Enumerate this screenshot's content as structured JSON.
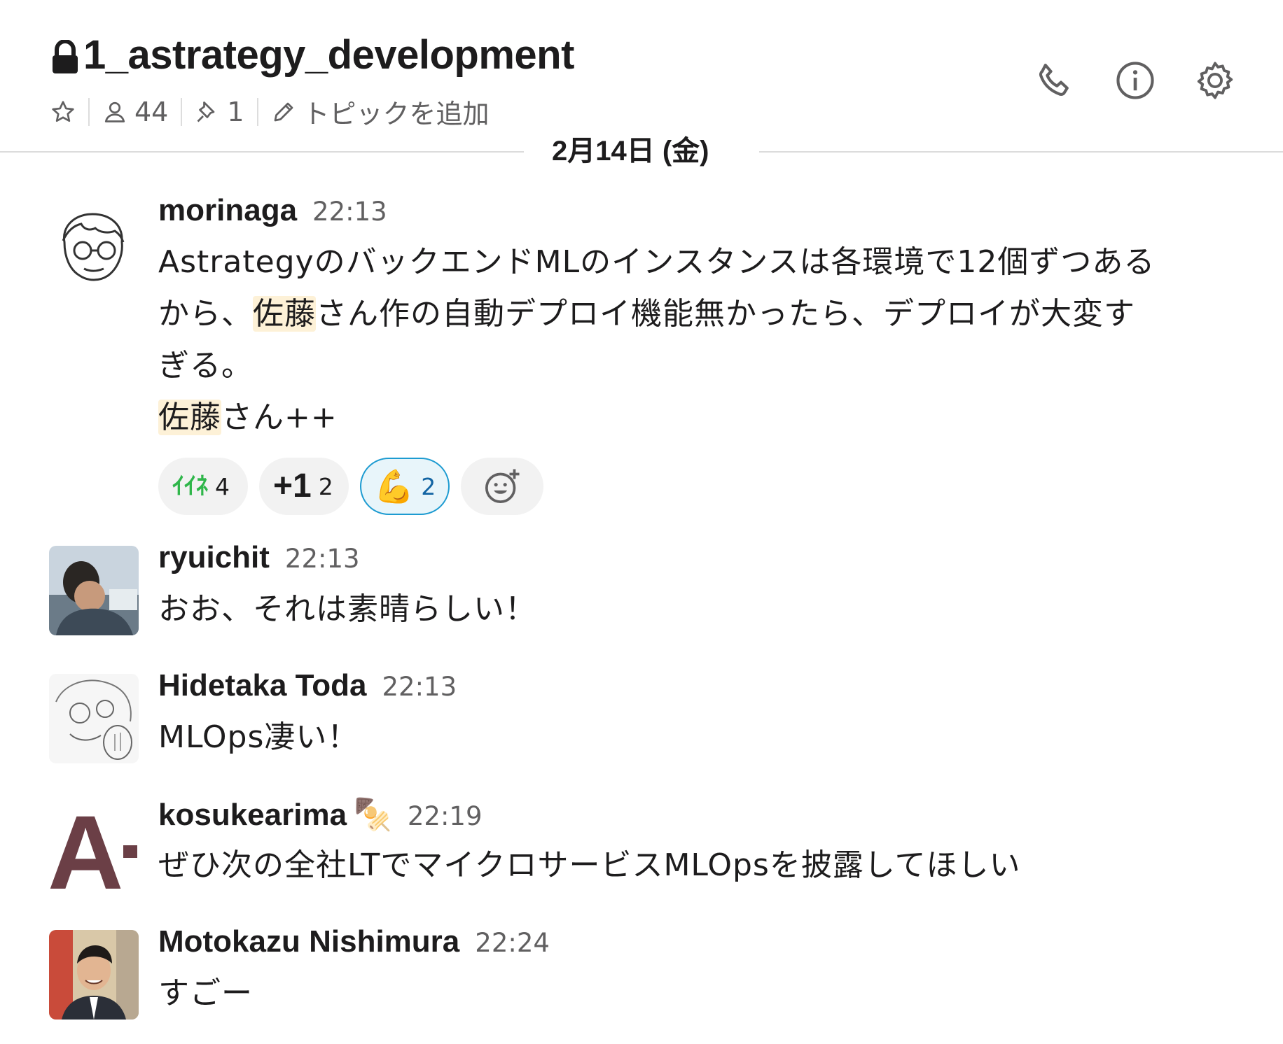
{
  "channel": {
    "name": "1_astrategy_development",
    "member_count": "44",
    "pinned_count": "1",
    "topic_placeholder": "トピックを追加"
  },
  "date_divider": "2月14日 (金)",
  "messages": [
    {
      "author": "morinaga",
      "time": "22:13",
      "text_parts": {
        "line1": "AstrategyのバックエンドMLのインスタンスは各環境で12個ずつある",
        "line2_prefix": "から、",
        "mention": "佐藤",
        "line2_suffix": "さん作の自動デプロイ機能無かったら、デプロイが大変す",
        "line3": "ぎる。",
        "line4_mention": "佐藤",
        "line4_suffix": "さん++"
      },
      "reactions": [
        {
          "emoji": "ｲｲﾈ",
          "count": "4"
        },
        {
          "emoji": "+1",
          "count": "2"
        },
        {
          "emoji": "💪",
          "count": "2"
        }
      ]
    },
    {
      "author": "ryuichit",
      "time": "22:13",
      "text": "おお、それは素晴らしい！"
    },
    {
      "author": "Hidetaka Toda",
      "time": "22:13",
      "text": "MLOps凄い！"
    },
    {
      "author": "kosukearima",
      "status_emoji": "🍢",
      "time": "22:19",
      "text": "ぜひ次の全社LTでマイクロサービスMLOpsを披露してほしい",
      "avatar_letter": "A"
    },
    {
      "author": "Motokazu Nishimura",
      "time": "22:24",
      "text": "すごー"
    }
  ],
  "icons": {
    "lock": "lock-icon",
    "star": "star-icon",
    "members": "person-icon",
    "pin": "pin-icon",
    "pencil": "pencil-icon",
    "call": "phone-icon",
    "info": "info-icon",
    "settings": "gear-icon",
    "add_reaction": "add-reaction-icon"
  },
  "colors": {
    "mention_bg": "#fdf1d7",
    "reaction_active_border": "#1d9bd1",
    "reaction_active_text": "#1264a3",
    "kosuke_avatar": "#6b3f46"
  }
}
